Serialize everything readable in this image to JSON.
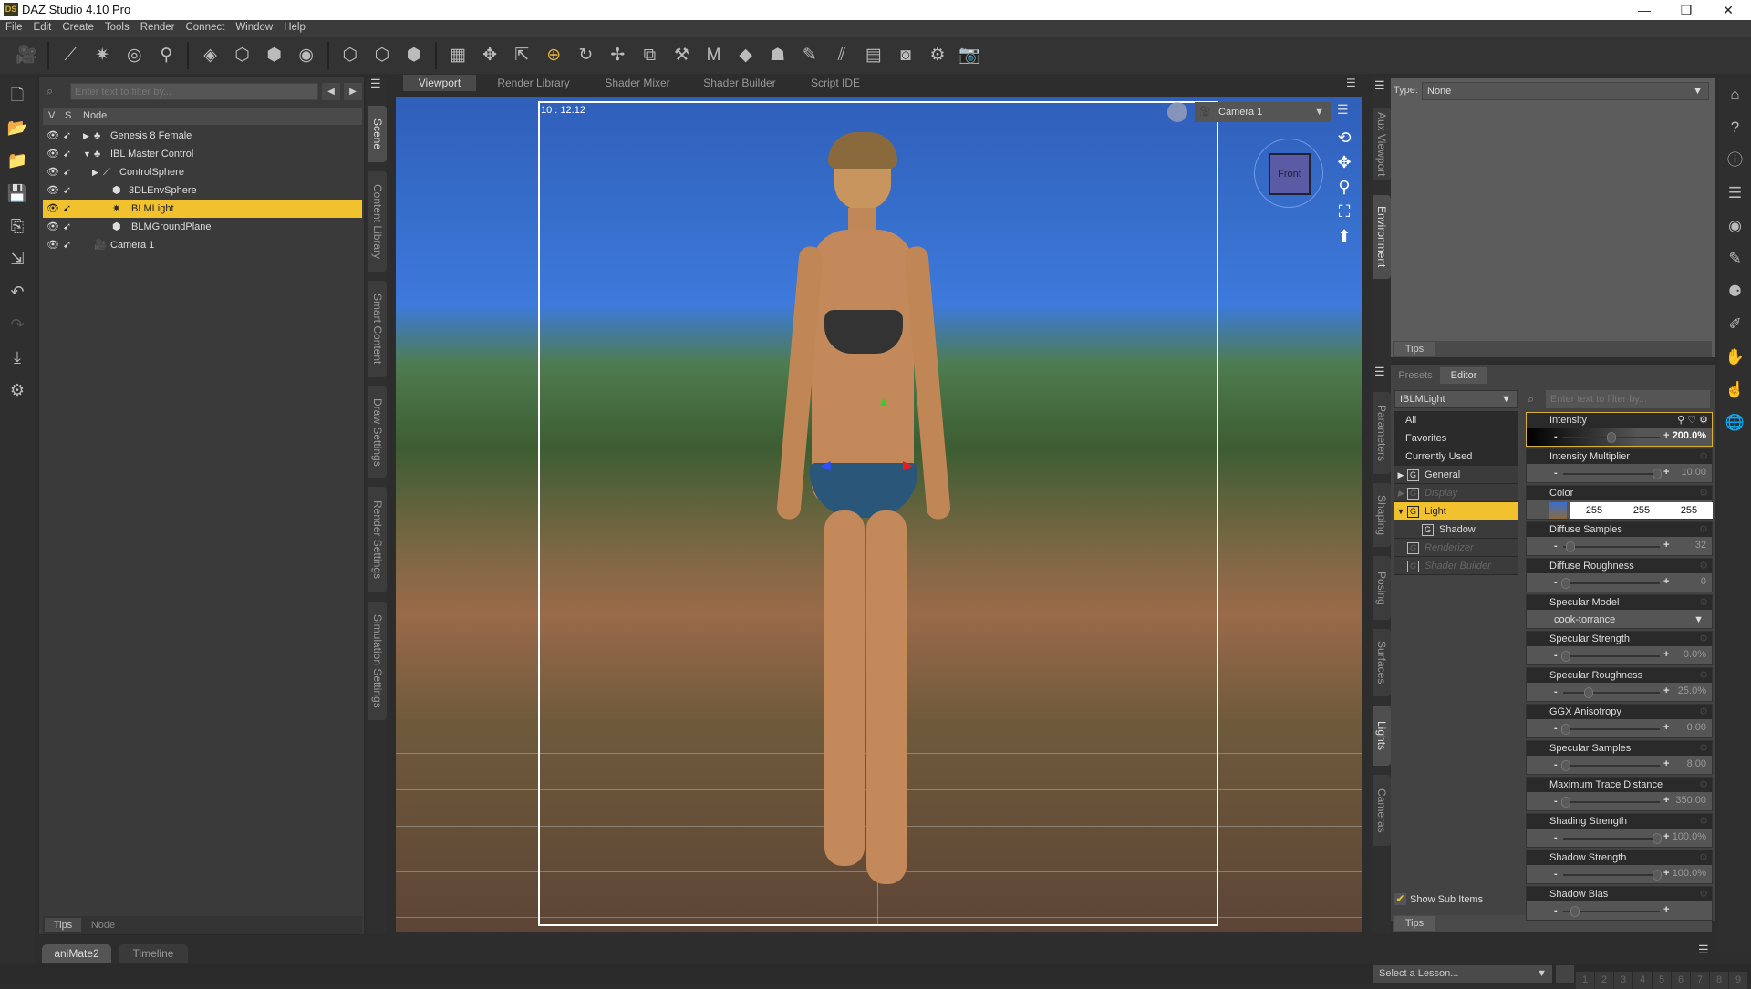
{
  "window": {
    "title": "DAZ Studio 4.10 Pro",
    "logo": "DS",
    "minimize": "—",
    "restore": "❐",
    "close": "✕"
  },
  "menu": [
    "File",
    "Edit",
    "Create",
    "Tools",
    "Render",
    "Connect",
    "Window",
    "Help"
  ],
  "toolbar": {
    "create_icons": [
      "new-camera-icon",
      "new-distant-light-icon",
      "new-spot-light-icon",
      "new-point-light-icon",
      "new-linear-light-icon",
      "new-primitive-icon",
      "new-null-icon",
      "new-group-icon",
      "new-plane-icon",
      "new-instance-icon",
      "new-group-node-icon",
      "new-proxy-icon"
    ],
    "tool_icons": [
      "universal-tool-icon",
      "node-selection-icon",
      "active-pose-tool-icon",
      "rotate-tool-icon",
      "translate-tool-icon",
      "scale-tool-icon",
      "joint-editor-icon",
      "morph-tool-icon",
      "geometry-editor-icon",
      "figure-tool-icon",
      "surface-selection-icon",
      "surface-editor-icon",
      "geometry-sculptor-icon",
      "camera-tool-icon",
      "spot-render-icon",
      "render-icon"
    ]
  },
  "left_toolbar": [
    "new-scene-icon",
    "open-icon",
    "merge-icon",
    "save-icon",
    "save-as-icon",
    "export-icon",
    "undo-icon",
    "redo-icon",
    "import-icon",
    "tools-icon"
  ],
  "scene": {
    "filter_placeholder": "Enter text to filter by...",
    "columns": {
      "v": "V",
      "s": "S",
      "node": "Node"
    },
    "nodes": [
      {
        "name": "Genesis 8 Female",
        "expander": "▶",
        "indent": 0,
        "icon": "figure-icon"
      },
      {
        "name": "IBL Master Control",
        "expander": "▼",
        "indent": 0,
        "icon": "group-icon"
      },
      {
        "name": "ControlSphere",
        "expander": "▶",
        "indent": 1,
        "icon": "bone-icon"
      },
      {
        "name": "3DLEnvSphere",
        "expander": "",
        "indent": 2,
        "icon": "primitive-icon"
      },
      {
        "name": "IBLMLight",
        "expander": "",
        "indent": 2,
        "icon": "light-icon",
        "selected": true
      },
      {
        "name": "IBLMGroundPlane",
        "expander": "",
        "indent": 2,
        "icon": "primitive-icon"
      },
      {
        "name": "Camera 1",
        "expander": "",
        "indent": 0,
        "icon": "camera-icon"
      }
    ],
    "bottom_tabs": [
      "Tips",
      "Node"
    ]
  },
  "left_vertical_tabs": [
    "Scene",
    "Content Library",
    "Smart Content",
    "Draw Settings",
    "Render Settings",
    "Simulation Settings"
  ],
  "viewport_tabs": [
    "Viewport",
    "Render Library",
    "Shader Mixer",
    "Shader Builder",
    "Script IDE"
  ],
  "viewport": {
    "aspect_readout": "10 : 12.12",
    "camera": "Camera 1",
    "cube_label": "Front",
    "nav_icons": [
      "orbit-icon",
      "pan-icon",
      "zoom-icon",
      "frame-icon",
      "reset-icon"
    ]
  },
  "aux": {
    "type_label": "Type:",
    "type_value": "None",
    "tabs": [
      "Aux Viewport",
      "Environment"
    ],
    "tips": "Tips"
  },
  "right_vertical_tabs": [
    "Parameters",
    "Shaping",
    "Posing",
    "Surfaces",
    "Lights",
    "Cameras"
  ],
  "lights": {
    "tabs": [
      "Presets",
      "Editor"
    ],
    "node_select": "IBLMLight",
    "filter_placeholder": "Enter text to filter by...",
    "groups": [
      {
        "label": "All",
        "type": "plain"
      },
      {
        "label": "Favorites",
        "type": "plain"
      },
      {
        "label": "Currently Used",
        "type": "plain"
      },
      {
        "label": "General",
        "type": "group",
        "expander": "▶"
      },
      {
        "label": "Display",
        "type": "group",
        "expander": "▶",
        "disabled": true
      },
      {
        "label": "Light",
        "type": "group",
        "expander": "▼",
        "selected": true
      },
      {
        "label": "Shadow",
        "type": "subgroup"
      },
      {
        "label": "Renderizer",
        "type": "group",
        "disabled": true
      },
      {
        "label": "Shader Builder",
        "type": "group",
        "disabled": true
      }
    ],
    "show_sub_items": "Show Sub Items",
    "show_sub_items_checked": true,
    "properties": [
      {
        "label": "Intensity",
        "value": "200.0%",
        "slider": 0.5,
        "highlighted": true
      },
      {
        "label": "Intensity Multiplier",
        "value": "10.00",
        "slider": 1.0
      },
      {
        "label": "Color",
        "type": "color",
        "rgb": [
          "255",
          "255",
          "255"
        ]
      },
      {
        "label": "Diffuse Samples",
        "value": "32",
        "slider": 0.05
      },
      {
        "label": "Diffuse Roughness",
        "value": "0",
        "slider": 0.0
      },
      {
        "label": "Specular Model",
        "type": "select",
        "value": "cook-torrance"
      },
      {
        "label": "Specular Strength",
        "value": "0.0%",
        "slider": 0.0
      },
      {
        "label": "Specular Roughness",
        "value": "25.0%",
        "slider": 0.25
      },
      {
        "label": "GGX Anisotropy",
        "value": "0.00",
        "slider": 0.0
      },
      {
        "label": "Specular Samples",
        "value": "8.00",
        "slider": 0.0
      },
      {
        "label": "Maximum Trace Distance",
        "value": "350.00",
        "slider": 0.0
      },
      {
        "label": "Shading Strength",
        "value": "100.0%",
        "slider": 1.0
      },
      {
        "label": "Shadow Strength",
        "value": "100.0%",
        "slider": 1.0
      },
      {
        "label": "Shadow Bias",
        "value": "",
        "slider": 0.1
      }
    ],
    "tips": "Tips"
  },
  "bottom": {
    "tabs": [
      "aniMate2",
      "Timeline"
    ],
    "lesson_placeholder": "Select a Lesson...",
    "lesson_steps": [
      "1",
      "2",
      "3",
      "4",
      "5",
      "6",
      "7",
      "8",
      "9"
    ]
  },
  "right_strip": [
    "ds-home-icon",
    "whats-this-icon",
    "help-icon",
    "panel-layout-icon",
    "target-icon",
    "figure-edit-icon",
    "pose-icon",
    "parameter-edit-icon",
    "hand-icon",
    "hand-pose-icon",
    "globe-edit-icon"
  ],
  "colors": {
    "accent": "#f2c12e",
    "panel": "#3a3a3a",
    "dark": "#2d2d2d"
  }
}
